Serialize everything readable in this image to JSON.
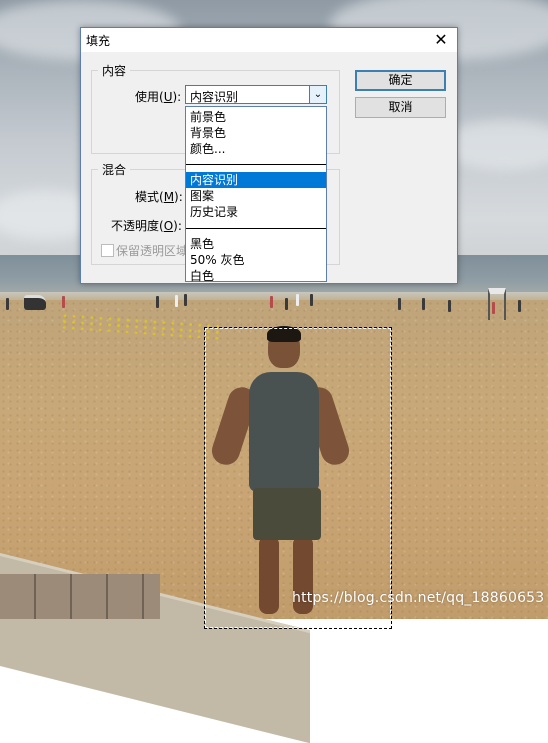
{
  "dialog": {
    "title": "填充",
    "close_glyph": "✕",
    "content_group": "内容",
    "use_label": "使用(",
    "use_key": "U",
    "use_label_end": "):",
    "use_value": "内容识别",
    "ok": "确定",
    "cancel": "取消",
    "blend_group": "混合",
    "mode_label": "模式(",
    "mode_key": "M",
    "mode_label_end": "):",
    "opacity_label": "不透明度(",
    "opacity_key": "O",
    "opacity_label_end": "):",
    "preserve_label": "保留透明区域"
  },
  "dropdown": {
    "group1": [
      "前景色",
      "背景色",
      "颜色..."
    ],
    "group2": [
      "内容识别",
      "图案",
      "历史记录"
    ],
    "group3": [
      "黑色",
      "50% 灰色",
      "白色"
    ],
    "selected": "内容识别"
  },
  "watermark": "https://blog.csdn.net/qq_18860653",
  "colors": {
    "selection": "#0078d7",
    "accent_border": "#3c7fb1"
  }
}
